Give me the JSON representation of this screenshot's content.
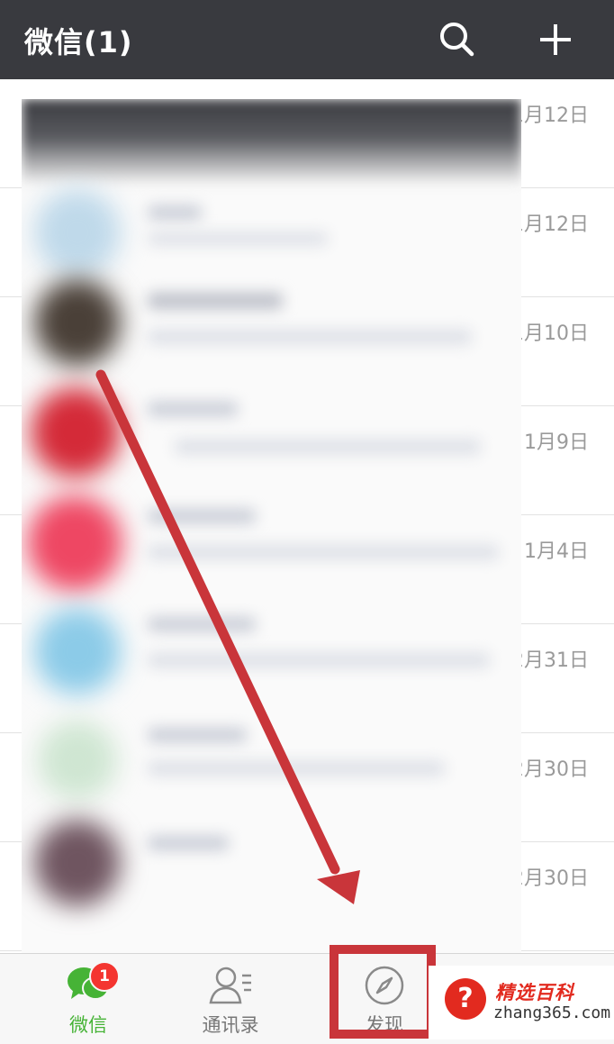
{
  "header": {
    "title": "微信(1)",
    "search_icon": "search-icon",
    "add_icon": "plus-icon"
  },
  "chats": [
    {
      "date": "1月12日"
    },
    {
      "date": "1月12日"
    },
    {
      "date": "1月10日"
    },
    {
      "date": "1月9日"
    },
    {
      "date": "1月4日"
    },
    {
      "date": "12月31日"
    },
    {
      "date": "12月30日"
    },
    {
      "date": "12月30日"
    }
  ],
  "tabbar": {
    "chat": {
      "label": "微信",
      "badge": "1",
      "color": "#46b336"
    },
    "contacts": {
      "label": "通讯录",
      "color": "#888888"
    },
    "discover": {
      "label": "发现",
      "color": "#888888"
    }
  },
  "annotation": {
    "color": "#c9353a"
  },
  "watermark": {
    "icon": "?",
    "name": "精选百科",
    "url": "zhang365.com"
  }
}
